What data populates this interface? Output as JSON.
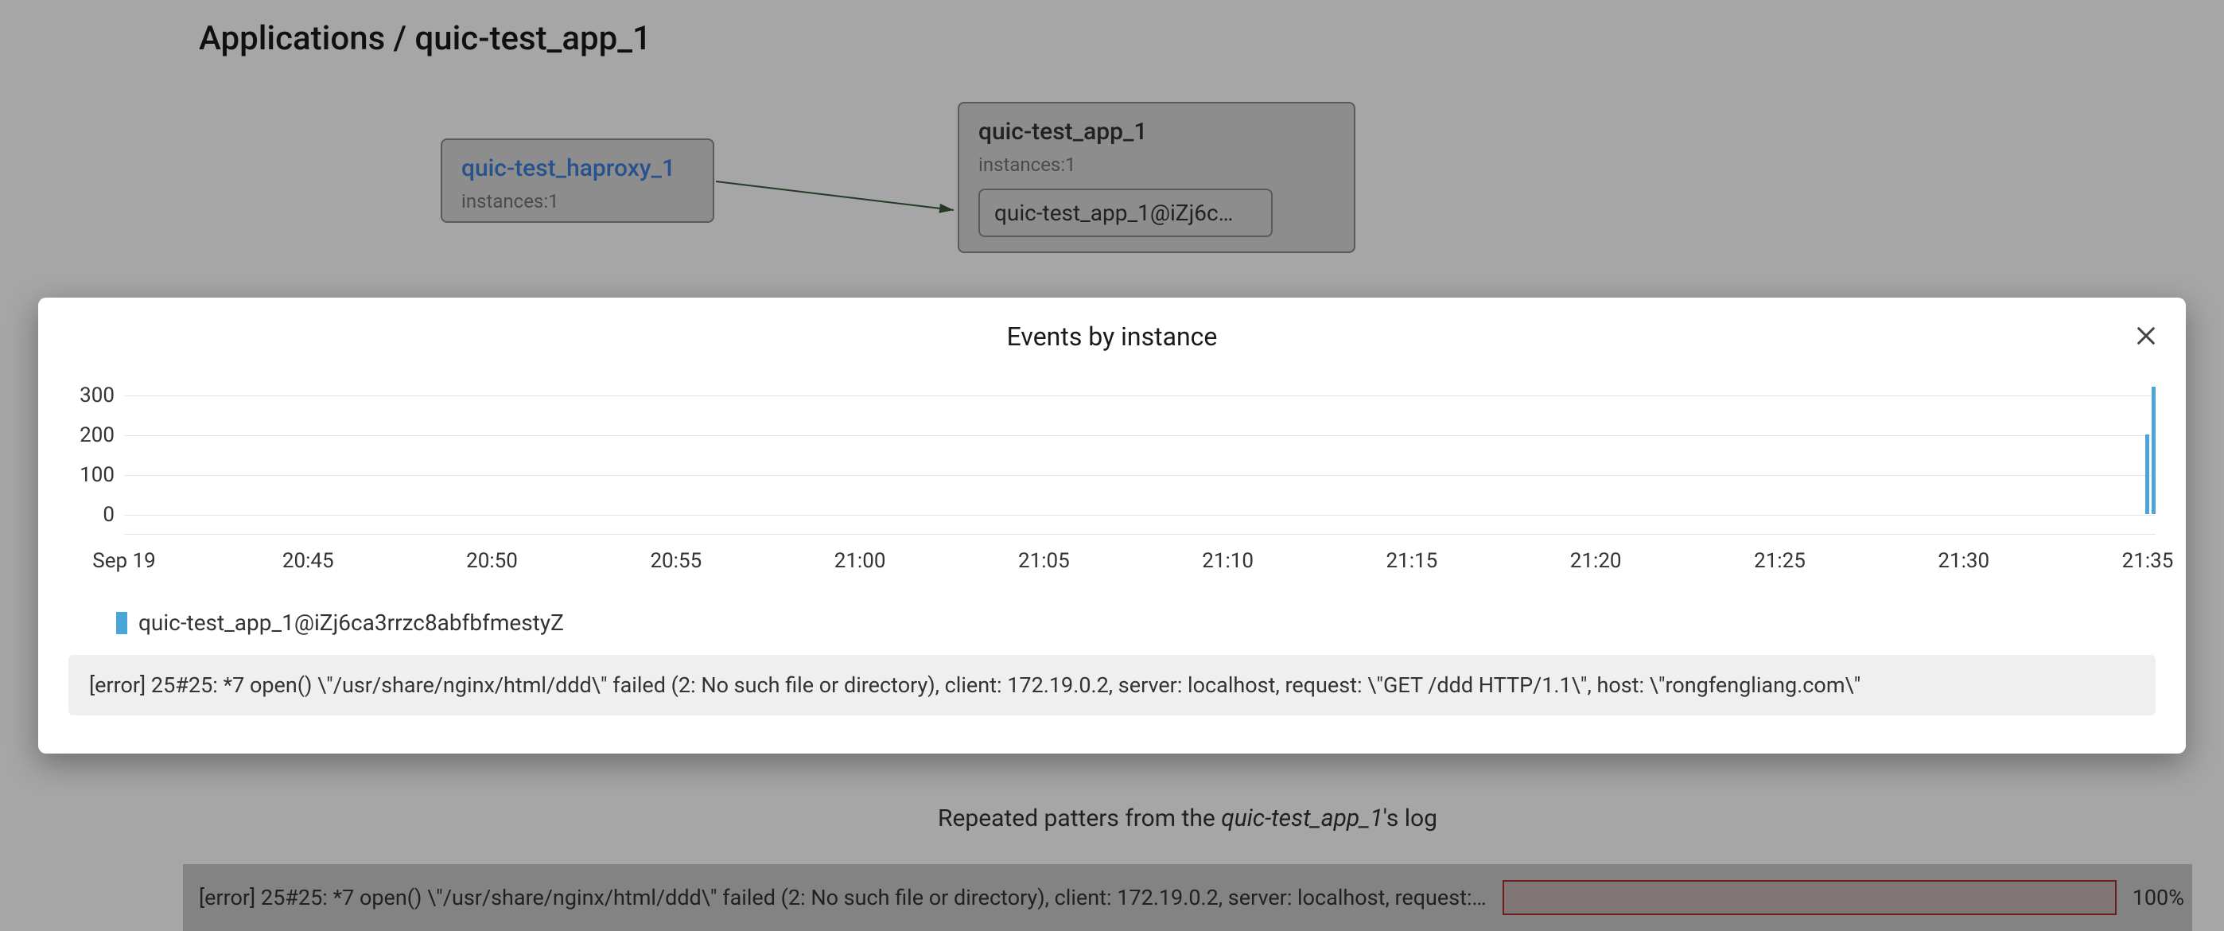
{
  "breadcrumb": {
    "full": "Applications / quic-test_app_1"
  },
  "nodes": {
    "haproxy": {
      "title": "quic-test_haproxy_1",
      "instances": "instances:1"
    },
    "app": {
      "title": "quic-test_app_1",
      "instances": "instances:1",
      "instance_label": "quic-test_app_1@iZj6c…"
    }
  },
  "modal": {
    "title": "Events by instance",
    "legend": "quic-test_app_1@iZj6ca3rrzc8abfbfmestyZ",
    "log_line": "[error] 25#25: *7 open() \\\"/usr/share/nginx/html/ddd\\\" failed (2: No such file or directory), client: 172.19.0.2, server: localhost, request: \\\"GET /ddd HTTP/1.1\\\", host: \\\"rongfengliang.com\\\""
  },
  "bottom": {
    "title_prefix": "Repeated patters from the ",
    "title_app": "quic-test_app_1",
    "title_suffix": "'s log",
    "row_text": "[error] 25#25: *7 open() \\\"/usr/share/nginx/html/ddd\\\" failed (2: No such file or directory), client: 172.19.0.2, server: localhost, request:…",
    "pct": "100%"
  },
  "colors": {
    "series": "#4aa6d6",
    "error_bar": "#b02a2a"
  },
  "chart_data": {
    "type": "bar",
    "title": "Events by instance",
    "xlabel": "",
    "ylabel": "",
    "ylim": [
      0,
      300
    ],
    "y_ticks": [
      0,
      100,
      200,
      300
    ],
    "categories": [
      "Sep 19",
      "20:45",
      "20:50",
      "20:55",
      "21:00",
      "21:05",
      "21:10",
      "21:15",
      "21:20",
      "21:25",
      "21:30",
      "21:35"
    ],
    "series": [
      {
        "name": "quic-test_app_1@iZj6ca3rrzc8abfbfmestyZ",
        "values": [
          0,
          0,
          0,
          0,
          0,
          0,
          0,
          0,
          0,
          0,
          0,
          0
        ],
        "extra_bars": [
          {
            "x_frac": 0.9955,
            "value": 200
          },
          {
            "x_frac": 0.999,
            "value": 320
          }
        ]
      }
    ]
  }
}
